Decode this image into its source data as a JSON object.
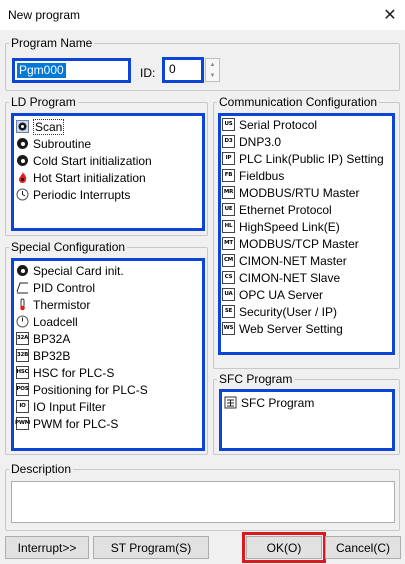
{
  "window": {
    "title": "New program",
    "close_glyph": "✕"
  },
  "program_name": {
    "legend": "Program Name",
    "value": "Pgm000",
    "id_label": "ID:",
    "id_value": "0"
  },
  "ld_program": {
    "legend": "LD Program",
    "items": [
      {
        "label": "Scan",
        "icon": "scan-icon"
      },
      {
        "label": "Subroutine",
        "icon": "subroutine-icon"
      },
      {
        "label": "Cold Start initialization",
        "icon": "cold-start-icon"
      },
      {
        "label": "Hot Start initialization",
        "icon": "hot-start-icon"
      },
      {
        "label": "Periodic Interrupts",
        "icon": "clock-icon"
      }
    ]
  },
  "communication": {
    "legend": "Communication Configuration",
    "items": [
      {
        "label": "Serial Protocol",
        "code": "US"
      },
      {
        "label": "DNP3.0",
        "code": "D3"
      },
      {
        "label": "PLC Link(Public IP) Setting",
        "code": "IP"
      },
      {
        "label": "Fieldbus",
        "code": "FB"
      },
      {
        "label": "MODBUS/RTU Master",
        "code": "MR"
      },
      {
        "label": "Ethernet Protocol",
        "code": "UE"
      },
      {
        "label": "HighSpeed Link(E)",
        "code": "HL"
      },
      {
        "label": "MODBUS/TCP Master",
        "code": "MT"
      },
      {
        "label": "CIMON-NET Master",
        "code": "CM"
      },
      {
        "label": "CIMON-NET Slave",
        "code": "CS"
      },
      {
        "label": "OPC UA Server",
        "code": "UA"
      },
      {
        "label": "Security(User / IP)",
        "code": "SE"
      },
      {
        "label": "Web Server Setting",
        "code": "WS"
      }
    ]
  },
  "special": {
    "legend": "Special Configuration",
    "items": [
      {
        "label": "Special Card init.",
        "icon": "special-card-icon"
      },
      {
        "label": "PID Control",
        "icon": "pid-icon"
      },
      {
        "label": "Thermistor",
        "icon": "thermistor-icon"
      },
      {
        "label": "Loadcell",
        "icon": "loadcell-icon"
      },
      {
        "label": "BP32A",
        "code": "32A"
      },
      {
        "label": "BP32B",
        "code": "32B"
      },
      {
        "label": "HSC for PLC-S",
        "code": "HSC"
      },
      {
        "label": "Positioning for PLC-S",
        "code": "POS"
      },
      {
        "label": "IO Input Filter",
        "code": "IO"
      },
      {
        "label": "PWM for PLC-S",
        "code": "PWM"
      }
    ]
  },
  "sfc": {
    "legend": "SFC Program",
    "items": [
      {
        "label": "SFC Program",
        "icon": "sfc-icon"
      }
    ]
  },
  "description": {
    "legend": "Description",
    "value": ""
  },
  "buttons": {
    "interrupt": "Interrupt>>",
    "st_program": "ST Program(S)",
    "ok": "OK(O)",
    "cancel": "Cancel(C)"
  },
  "colors": {
    "highlight_box": "#0b44d6",
    "ok_highlight": "#d81920",
    "selection": "#0078d7"
  }
}
